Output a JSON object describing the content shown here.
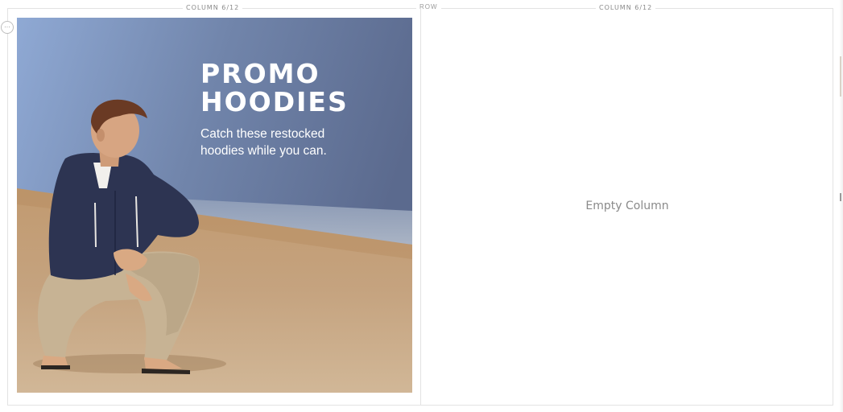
{
  "row": {
    "label": "ROW"
  },
  "columns": [
    {
      "label": "COLUMN 6/12"
    },
    {
      "label": "COLUMN 6/12",
      "empty_text": "Empty Column"
    }
  ],
  "promo": {
    "title_line1": "PROMO",
    "title_line2": "HOODIES",
    "subtitle_line1": "Catch these restocked",
    "subtitle_line2": "hoodies while you can."
  },
  "handle": {
    "icon": "ellipsis-icon",
    "glyph": "···"
  }
}
